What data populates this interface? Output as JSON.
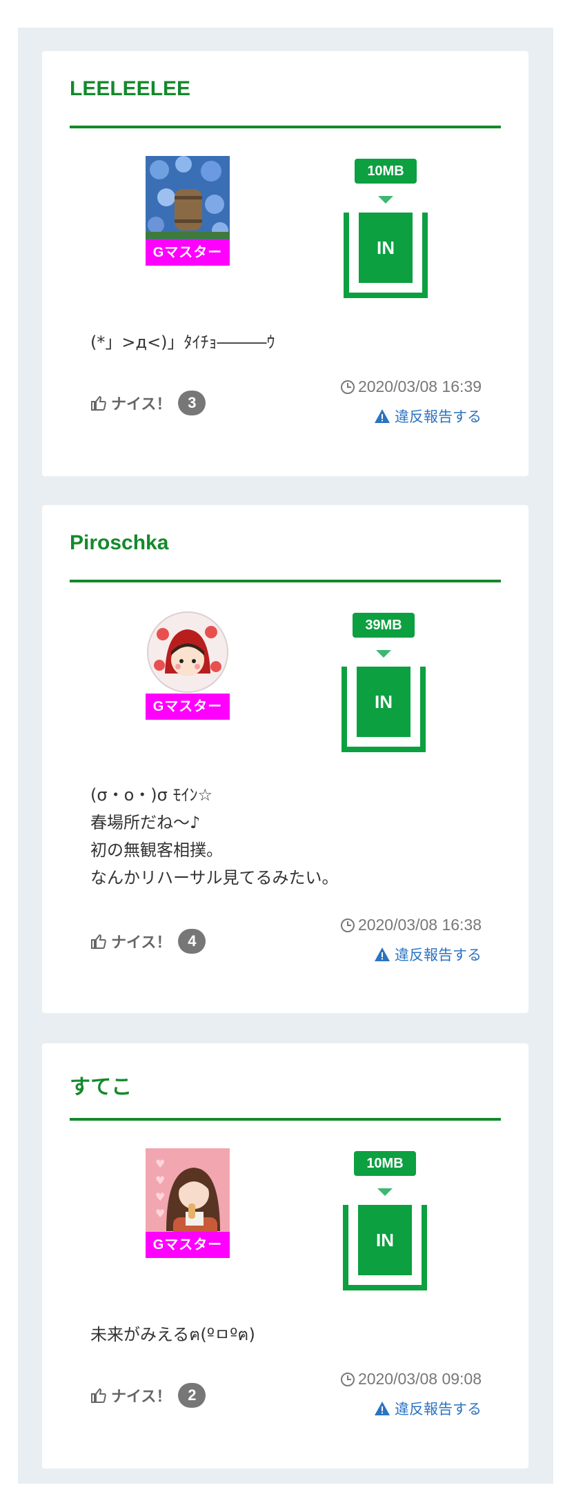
{
  "posts": [
    {
      "username": "LEELEELEE",
      "rank": "Gマスター",
      "size": "10MB",
      "bin_label": "IN",
      "comment": "(*」>д<)」ﾀｲﾁｮ―――ｳ",
      "nice_label": "ナイス！",
      "nice_count": "3",
      "timestamp": "2020/03/08 16:39",
      "report_label": "違反報告する"
    },
    {
      "username": "Piroschka",
      "rank": "Gマスター",
      "size": "39MB",
      "bin_label": "IN",
      "comment": "(σ・o・)σ ﾓｲﾝ☆\n春場所だね～♪\n初の無観客相撲。\nなんかリハーサル見てるみたい。",
      "nice_label": "ナイス！",
      "nice_count": "4",
      "timestamp": "2020/03/08 16:38",
      "report_label": "違反報告する"
    },
    {
      "username": "すてこ",
      "rank": "Gマスター",
      "size": "10MB",
      "bin_label": "IN",
      "comment": "未来がみえるฅ(ºㅁºฅ)",
      "nice_label": "ナイス！",
      "nice_count": "2",
      "timestamp": "2020/03/08 09:08",
      "report_label": "違反報告する"
    }
  ],
  "colors": {
    "username": "#14892c",
    "badge_green": "#0ca040",
    "rank_badge": "#ff00ff",
    "report_link": "#2b73c2",
    "background": "#e9eef2"
  },
  "icons": [
    "thumbs-up-icon",
    "clock-icon",
    "warning-icon"
  ]
}
